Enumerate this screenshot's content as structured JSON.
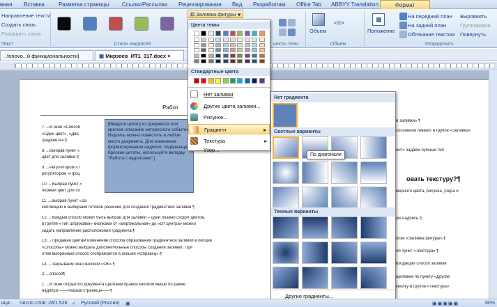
{
  "tabs": [
    "вная",
    "Вставка",
    "Разметка страницы",
    "Ссылки",
    "Рассылки",
    "Рецензирование",
    "Вид",
    "Разработчик",
    "Office Tab",
    "ABBYY Translation",
    "Формат"
  ],
  "ribbon": {
    "text_group": {
      "items": [
        "Направление текста",
        "Создать связь",
        "Разорвать связь"
      ],
      "label": "Текст"
    },
    "styles_label": "Стили надписей",
    "swatch_colors": [
      "#0a0a0a",
      "#4f81bd",
      "#c0504d",
      "#9bbb59",
      "#8064a2"
    ],
    "fill_button": "Заливка фигуры",
    "shadow_label": "ьекты тени",
    "volume": {
      "button": "Объем",
      "label": "Объем"
    },
    "position_button": "Положение",
    "arrange": {
      "items": [
        "На передний план",
        "На задний план",
        "Обтекание текстом"
      ],
      "items2": [
        "Выровнять",
        "Группировка",
        "Повернуть"
      ],
      "label": "Упорядочить"
    }
  },
  "doc_tabs": [
    "..fonovo...й функциональности]",
    "Мирзоев_ИТ1_317.docx"
  ],
  "fill_menu": {
    "theme_header": "Цвета темы",
    "standard_header": "Стандартные цвета",
    "theme_colors": [
      "#ffffff",
      "#000000",
      "#eeece1",
      "#1f497d",
      "#4f81bd",
      "#c0504d",
      "#9bbb59",
      "#8064a2",
      "#4bacc6",
      "#f79646"
    ],
    "standard_colors": [
      "#c00000",
      "#ff0000",
      "#ffc000",
      "#ffff00",
      "#92d050",
      "#00b050",
      "#00b0f0",
      "#0070c0",
      "#002060",
      "#7030a0"
    ],
    "items": [
      {
        "label": "Нет заливки",
        "icon": "no-fill-icon"
      },
      {
        "label": "Другие цвета заливки...",
        "icon": "palette-icon"
      },
      {
        "label": "Рисунок...",
        "icon": "picture-icon"
      },
      {
        "label": "Градиент",
        "icon": "gradient-icon"
      },
      {
        "label": "Текстура",
        "icon": "texture-icon"
      },
      {
        "label": "Узор...",
        "icon": ""
      }
    ]
  },
  "gradient_menu": {
    "no_gradient": "Нет градиента",
    "light_header": "Светлые варианты",
    "dark_header": "Темные варианты",
    "more": "Другие градиенты...",
    "tooltip": "По диагонали"
  },
  "quote": "[Введите цитату из документа или краткое описание интересного события. Надпись можно поместить в любое место документа. Для изменения форматирования надписи, содержащей броские цитаты, используйте вкладку \"Работа с надписями\".]",
  "doc": {
    "heading": "Работ",
    "right_heading": "овать текстуру?¶",
    "left_lines": [
      "7.→В окне «Способ",
      "«Один цвет», «Два",
      "градиента».¶",
      "8.→Выбрав пункт «",
      "цвет для заливки.¶",
      "9.→Регулятором «Т",
      "регулятором «Проц",
      "10.→Выбрав пункт «",
      "первый цвет для со",
      "11.→Выбрав пункт «За",
      "коллекцию и выбираем готовое решение для создания градиентной заливки.¶",
      "12.→Каждый способ может быть выбран для заливки – одни плавно сходят цветов,",
      "в группе «Тип штриховки» кнопками от «Вертикальная» до «От центра» можно",
      "задать направление расположения градиента.¶",
      "13.→Придавая цветам изменение способа образования градиентной заливки в окошке",
      "«Способы» можно выбрать дополнительные способы создания заливки. При",
      "этом выбранный способ отображается в окошке «Образец».¶",
      "14.→Закрываем окно кнопкой «ОК».¶",
      "2.→способ¶",
      "1.→В окне открытого документа щелкаем правой кнопкой мыши по рамке",
      "надписи.——Разрыв страницы——¶"
    ],
    "right_lines": [
      "и заливки».¶",
      "сосновной линии» в группе «Заливка»",
      "ент» задаем нужный тип",
      "мерного цвета, рисунка, узора и",
      "ую надпись.¶",
      "опки «Заливка фигуры».¶",
      "ля пункт «Текстура».¶",
      "входящий способ заливки",
      "щелкаем по пункту «Другие",
      "кнопку в группе «Текстура»"
    ]
  },
  "status": {
    "page": "ица:",
    "words": "Число слов: 28/1 526",
    "lang": "Русский (Россия)",
    "zoom": "80%"
  }
}
